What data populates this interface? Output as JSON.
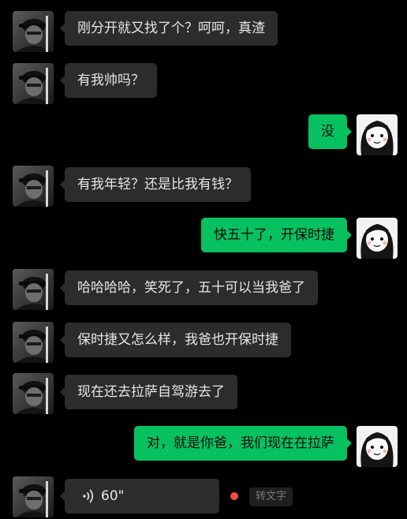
{
  "messages": [
    {
      "text": "刚分开就又找了个？呵呵，真渣"
    },
    {
      "text": "有我帅吗？"
    },
    {
      "text": "没"
    },
    {
      "text": "有我年轻？还是比我有钱？"
    },
    {
      "text": "快五十了，开保时捷"
    },
    {
      "text": "哈哈哈哈，笑死了，五十可以当我爸了"
    },
    {
      "text": "保时捷又怎么样，我爸也开保时捷"
    },
    {
      "text": "现在还去拉萨自驾游去了"
    },
    {
      "text": "对，就是你爸，我们现在在拉萨"
    }
  ],
  "voice_message": {
    "duration": "60\"",
    "convert_label": "转文字"
  },
  "colors": {
    "background": "#000000",
    "incoming_bubble": "#2c2c2c",
    "outgoing_bubble": "#07c160",
    "unread_dot": "#f24b42"
  },
  "icons": [
    "man-avatar",
    "girl-avatar",
    "voice-wave-icon",
    "unread-dot"
  ]
}
